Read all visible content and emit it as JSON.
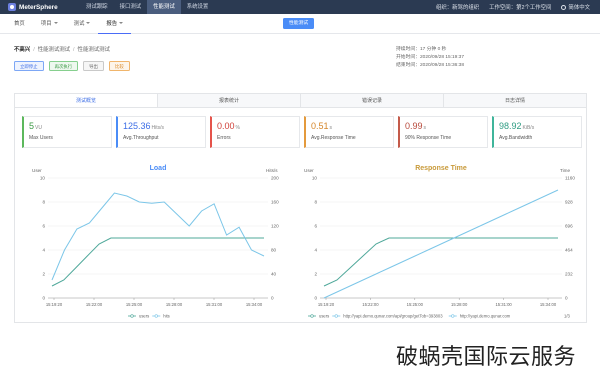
{
  "app": {
    "name": "MeterSphere"
  },
  "topnav": {
    "items": [
      "测试跟踪",
      "接口测试",
      "性能测试",
      "系统设置"
    ],
    "active": 2
  },
  "topright": {
    "org": "组织：新驾的组织",
    "workspace": "工作空间：第2个工作空间",
    "language": "简体中文"
  },
  "subnav": {
    "tabs": [
      "首页",
      "项目",
      "测试",
      "报告"
    ],
    "active": 3,
    "create": "性能测试"
  },
  "report": {
    "breadcrumb": [
      "不高兴",
      "性能测试测试",
      "性能测试测试"
    ],
    "actions": [
      "立即停止",
      "再次执行",
      "导出",
      "比较"
    ],
    "duration": "持续时间：17 分钟 0 秒",
    "start": "开始时间：2020/09/28 15:19:37",
    "end": "结束时间：2020/09/28 15:36:38"
  },
  "result_tabs": {
    "items": [
      "测试概览",
      "报表统计",
      "错误记录",
      "日志详情"
    ],
    "active": 0
  },
  "stats": [
    {
      "value": "5",
      "unit": "VU",
      "label": "Max Users"
    },
    {
      "value": "125.36",
      "unit": "Hits/s",
      "label": "Avg.Throughput"
    },
    {
      "value": "0.00",
      "unit": "%",
      "label": "Errors"
    },
    {
      "value": "0.51",
      "unit": "s",
      "label": "Avg.Response Time"
    },
    {
      "value": "0.99",
      "unit": "s",
      "label": "90% Response Time"
    },
    {
      "value": "98.92",
      "unit": "KiB/s",
      "label": "Avg.Bandwidth"
    }
  ],
  "colors": {
    "accent": "#4a8cf7",
    "topbar": "#2b3a52",
    "series": "#5ab4a6"
  },
  "chart_data": [
    {
      "type": "line",
      "title": "Load",
      "ylabel": "User",
      "y2label": "Hits/s",
      "x": [
        "15:19:20",
        "15:22:00",
        "15:25:00",
        "15:28:00",
        "15:31:00",
        "15:34:00"
      ],
      "ylim": [
        0,
        10
      ],
      "yticks": [
        0,
        2,
        4,
        6,
        8,
        10
      ],
      "y2lim": [
        0,
        200
      ],
      "y2ticks": [
        0,
        40,
        80,
        120,
        160,
        200
      ],
      "series": [
        {
          "name": "users",
          "axis": "left",
          "values": [
            1,
            1.5,
            2.5,
            3.5,
            4.5,
            5,
            5,
            5,
            5,
            5,
            5,
            5,
            5,
            5,
            5,
            5,
            5,
            5,
            5
          ]
        },
        {
          "name": "hits",
          "axis": "right",
          "values": [
            30,
            80,
            115,
            125,
            150,
            175,
            170,
            160,
            158,
            160,
            140,
            120,
            145,
            157,
            105,
            118,
            80,
            70
          ]
        }
      ]
    },
    {
      "type": "line",
      "title": "Response Time",
      "ylabel": "User",
      "y2label": "Time",
      "x": [
        "15:19:20",
        "15:22:00",
        "15:25:00",
        "15:28:00",
        "15:31:00",
        "15:34:00"
      ],
      "ylim": [
        0,
        10
      ],
      "yticks": [
        0,
        2,
        4,
        6,
        8,
        10
      ],
      "y2lim": [
        0,
        1160
      ],
      "y2ticks": [
        0,
        232,
        464,
        696,
        928,
        1160
      ],
      "series": [
        {
          "name": "users",
          "axis": "left",
          "values": [
            1,
            1.5,
            2.5,
            3.5,
            4.5,
            5,
            5,
            5,
            5,
            5,
            5,
            5,
            5,
            5,
            5,
            5,
            5,
            5,
            5
          ]
        },
        {
          "name": "http://yapi.demo.qunar.com/api/group/getTob=393803",
          "axis": "right",
          "values": [
            0,
            58,
            116,
            174,
            232,
            290,
            348,
            406,
            464,
            522,
            580,
            638,
            696,
            754,
            812,
            870,
            928,
            986,
            1044
          ]
        },
        {
          "name": "http://yapi.demo.qunar.com",
          "axis": "right",
          "values": []
        }
      ],
      "legend_pager": "1/3"
    }
  ],
  "watermark": "破蜗壳国际云服务"
}
